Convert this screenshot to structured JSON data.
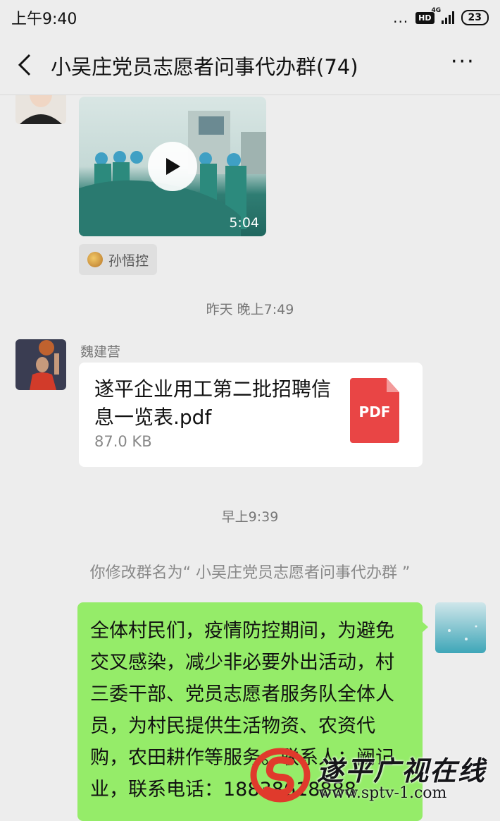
{
  "status_bar": {
    "time": "上午9:40",
    "dots": "...",
    "hd_badge": "HD",
    "network": "4G",
    "battery": "23"
  },
  "header": {
    "title": "小吴庄党员志愿者问事代办群(74)",
    "more": "···"
  },
  "messages": {
    "video": {
      "duration": "5:04"
    },
    "reaction": {
      "name": "孙悟控"
    },
    "timestamp1": "昨天 晚上7:49",
    "file_message": {
      "sender": "魏建营",
      "file_name": "遂平企业用工第二批招聘信息一览表.pdf",
      "file_size": "87.0 KB",
      "file_type": "PDF"
    },
    "timestamp2": "早上9:39",
    "system": "你修改群名为“ 小吴庄党员志愿者问事代办群 ”",
    "notice": "全体村民们，疫情防控期间，为避免交叉感染，减少非必要外出活动，村三委干部、党员志愿者服务队全体人员，为村民提供生活物资、农资代购，农田耕作等服务。联系人：阙记业，联系电话：18838618888"
  },
  "watermark": {
    "station": "遂平广视在线",
    "url": "www.sptv-1.com"
  },
  "colors": {
    "background": "#ededed",
    "bubble_green": "#95ec69",
    "pdf_red": "#e94545",
    "phone_link": "#3b73c4"
  }
}
